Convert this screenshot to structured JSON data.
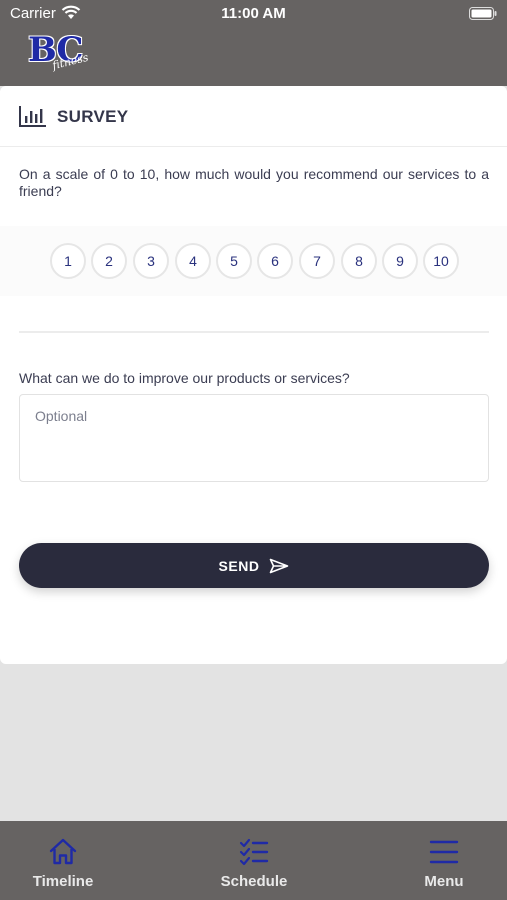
{
  "status_bar": {
    "carrier": "Carrier",
    "time": "11:00 AM"
  },
  "brand": {
    "logo_text": "BC",
    "logo_script": "fitness"
  },
  "survey": {
    "title": "SURVEY",
    "question_recommend": "On a scale of 0 to 10, how much would you recommend our services to a friend?",
    "scale": [
      "1",
      "2",
      "3",
      "4",
      "5",
      "6",
      "7",
      "8",
      "9",
      "10"
    ],
    "question_improve": "What can we do to improve our products or services?",
    "improve_placeholder": "Optional",
    "send_label": "SEND"
  },
  "tabbar": {
    "items": [
      {
        "label": "Timeline",
        "icon": "home-icon"
      },
      {
        "label": "Schedule",
        "icon": "checklist-icon"
      },
      {
        "label": "Menu",
        "icon": "hamburger-menu-icon"
      }
    ]
  },
  "colors": {
    "header_bg": "#666362",
    "accent_blue": "#1f2aa6",
    "button_dark": "#2a2b3d",
    "scale_text": "#2a327e"
  }
}
